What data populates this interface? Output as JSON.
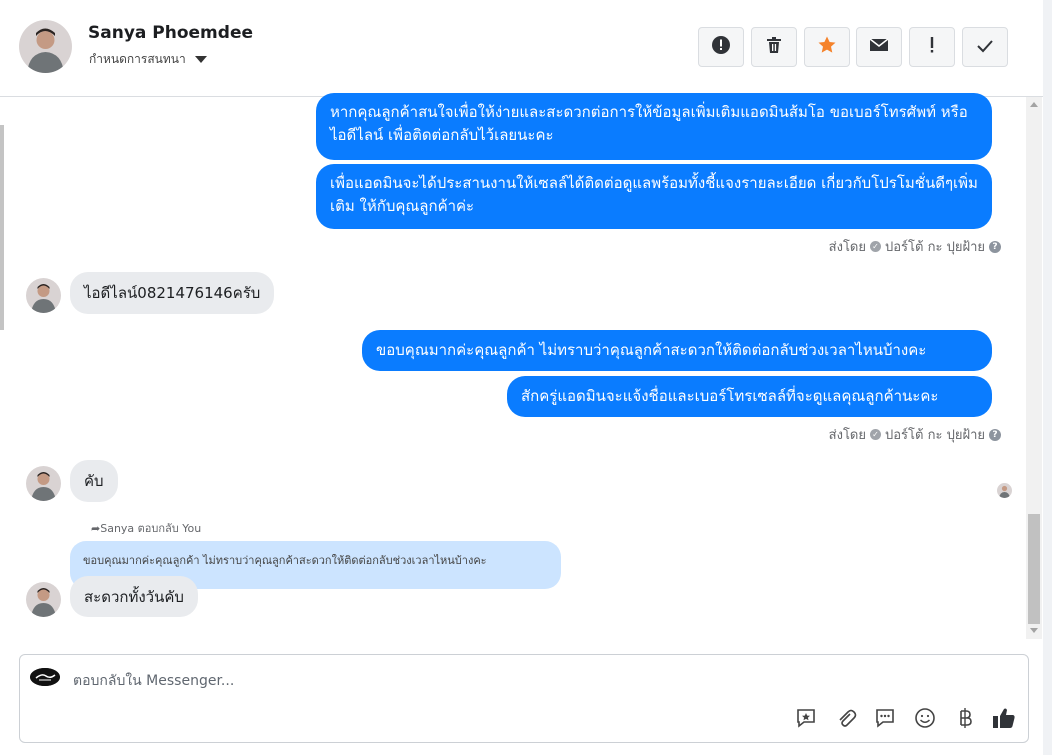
{
  "header": {
    "name": "Sanya Phoemdee",
    "assign_label": "กำหนดการสนทนา",
    "actions": [
      {
        "name": "mark-spam",
        "icon": "alert-circle-icon"
      },
      {
        "name": "delete",
        "icon": "trash-icon"
      },
      {
        "name": "star",
        "icon": "star-icon",
        "color": "#f5822a"
      },
      {
        "name": "mark-unread",
        "icon": "envelope-icon"
      },
      {
        "name": "follow-up",
        "icon": "exclamation-icon"
      },
      {
        "name": "mark-done",
        "icon": "checkmark-icon"
      }
    ]
  },
  "messages": {
    "out1": "หากคุณลูกค้าสนใจเพื่อให้ง่ายและสะดวกต่อการให้ข้อมูลเพิ่มเติมแอดมินส้มโอ ขอเบอร์โทรศัพท์ หรือ ไอดีไลน์ เพื่อติดต่อกลับไว้เลยนะคะ",
    "out2": "เพื่อแอดมินจะได้ประสานงานให้เซลล์ได้ติดต่อดูแลพร้อมทั้งชี้แจงรายละเอียด เกี่ยวกับโปรโมชั่นดีๆเพิ่มเติม ให้กับคุณลูกค้าค่ะ",
    "sent_by_1": "ส่งโดย",
    "sender_1": "ปอร์โต้ กะ ปุยฝ้าย",
    "in1": "ไอดีไลน์0821476146ครับ",
    "out3": "ขอบคุณมากค่ะคุณลูกค้า ไม่ทราบว่าคุณลูกค้าสะดวกให้ติดต่อกลับช่วงเวลาไหนบ้างคะ",
    "out4": "สักครู่แอดมินจะแจ้งชื่อและเบอร์โทรเซลล์ที่จะดูแลคุณลูกค้านะคะ",
    "sent_by_2": "ส่งโดย",
    "sender_2": "ปอร์โต้ กะ ปุยฝ้าย",
    "in2": "คับ",
    "reply_header": "Sanya ตอบกลับ You",
    "quoted": "ขอบคุณมากค่ะคุณลูกค้า ไม่ทราบว่าคุณลูกค้าสะดวกให้ติดต่อกลับช่วงเวลาไหนบ้างคะ",
    "in3": "สะดวกทั้งวันคับ"
  },
  "composer": {
    "placeholder": "ตอบกลับใน Messenger...",
    "tools": [
      "saved-reply-icon",
      "attachment-icon",
      "chat-bubble-icon",
      "emoji-icon",
      "baht-icon",
      "thumbs-up-icon"
    ]
  },
  "colors": {
    "outgoing_bubble": "#0a7cff",
    "incoming_bubble": "#e9ebee",
    "quote_bubble": "#cce4ff",
    "star": "#f5822a"
  }
}
